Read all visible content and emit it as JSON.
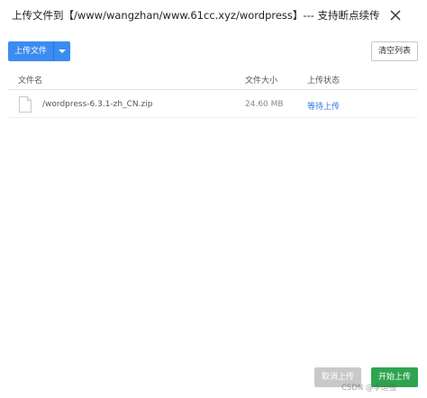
{
  "window": {
    "title": "上传文件到【/www/wangzhan/www.61cc.xyz/wordpress】--- 支持断点续传"
  },
  "toolbar": {
    "upload_label": "上传文件",
    "clear_label": "清空列表"
  },
  "table": {
    "headers": [
      "文件名",
      "文件大小",
      "上传状态"
    ],
    "rows": [
      {
        "name": "/wordpress-6.3.1-zh_CN.zip",
        "size": "24.60 MB",
        "status": "等待上传"
      }
    ]
  },
  "footer": {
    "cancel_label": "取消上传",
    "start_label": "开始上传"
  },
  "watermark": "CSDN @李运强",
  "icons": {
    "close": "close-icon",
    "dropdown": "caret-down-icon",
    "file": "file-icon"
  },
  "colors": {
    "primary": "#3b8cf0",
    "success": "#2ea44f",
    "status_link": "#2f7ae5",
    "disabled": "#c9c9c9"
  }
}
